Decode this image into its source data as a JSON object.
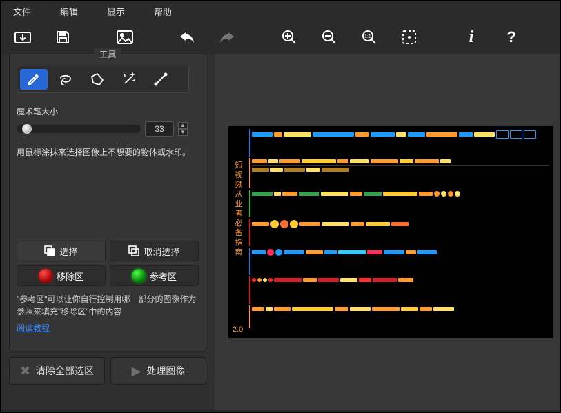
{
  "menu": {
    "file": "文件",
    "edit": "编辑",
    "view": "显示",
    "help": "帮助"
  },
  "toolbar_icons": [
    "open",
    "save",
    "image",
    "undo",
    "redo",
    "zoom-in",
    "zoom-out",
    "zoom-actual",
    "zoom-fit",
    "info",
    "help"
  ],
  "panel": {
    "title": "工具",
    "brush_size_label": "魔术笔大小",
    "brush_size_value": "33",
    "hint": "用鼠标涂抹来选择图像上不想要的物体或水印。",
    "select_label": "选择",
    "deselect_label": "取消选择",
    "remove_label": "移除区",
    "reference_label": "参考区",
    "description": "\"参考区\"可以让你自行控制用哪一部分的图像作为参照来填充\"移除区\"中的内容",
    "tutorial_link": "阅读教程"
  },
  "bottom": {
    "clear_all": "清除全部选区",
    "process": "处理图像"
  },
  "preview_vertical_title": "短视频从业者必备指南",
  "preview_version": "2.0"
}
